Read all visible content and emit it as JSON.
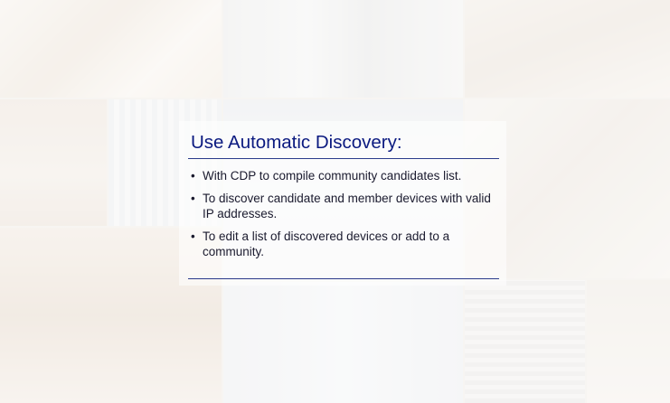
{
  "slide": {
    "title": "Use Automatic Discovery:",
    "bullet_glyph": "•",
    "bullets": [
      {
        "text": "With CDP to compile community candidates list."
      },
      {
        "text": "To discover candidate and member devices with valid IP addresses."
      },
      {
        "text": "To edit a list of discovered devices or add to a community."
      }
    ]
  },
  "colors": {
    "title": "#0b1a80",
    "rule": "#2a3a8a",
    "body_text": "#1a1a2e"
  }
}
